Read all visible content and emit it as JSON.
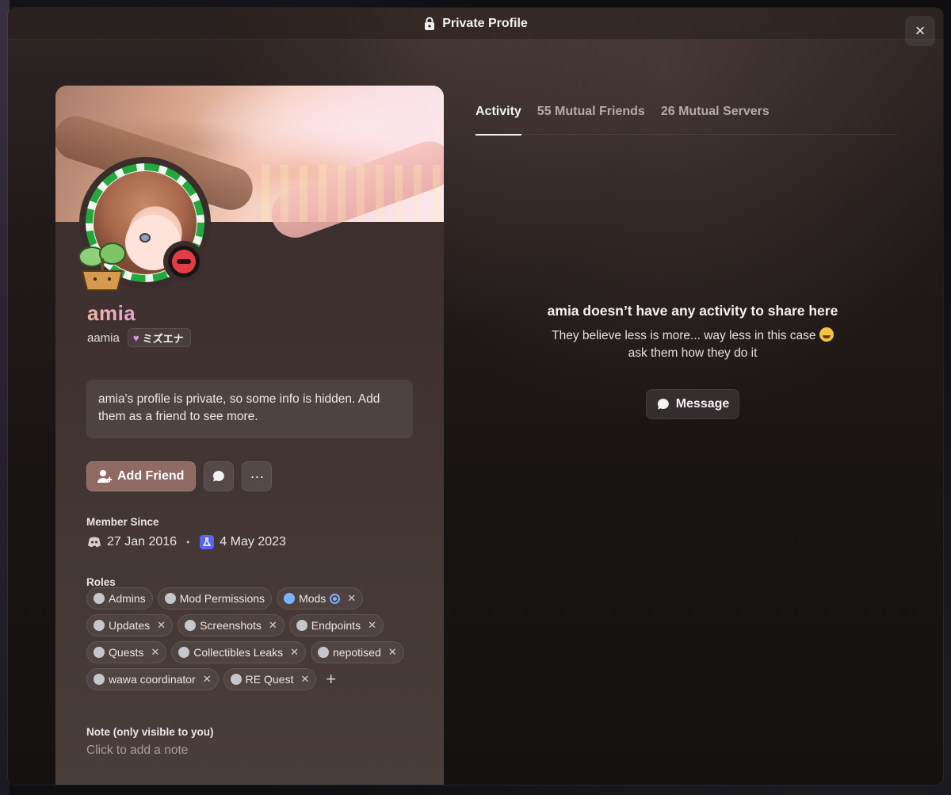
{
  "modal": {
    "title": "Private Profile",
    "close_label": "×"
  },
  "profile": {
    "display_name": "amia",
    "username": "aamia",
    "guild_tag": "ミズエナ",
    "private_notice": "amia's profile is private, so some info is hidden. Add them as a friend to see more.",
    "status": "do-not-disturb",
    "name_gradient": [
      "#f3b6a9",
      "#e79fd0"
    ]
  },
  "actions": {
    "add_friend_label": "Add Friend",
    "message_icon": "chat-bubble-icon",
    "more_icon": "ellipsis-icon",
    "more_label": "···"
  },
  "member_since": {
    "label": "Member Since",
    "discord_date": "27 Jan 2016",
    "server_date": "4 May 2023"
  },
  "roles": {
    "label": "Roles",
    "rows": [
      [
        {
          "name": "Admins",
          "removable": false,
          "color": "#c4c7cc"
        },
        {
          "name": "Mod Permissions",
          "removable": false,
          "color": "#c4c7cc"
        },
        {
          "name": "Mods",
          "removable": true,
          "color": "#7ab2ff",
          "badge": true
        }
      ],
      [
        {
          "name": "Updates",
          "removable": true,
          "color": "#c4c7cc"
        },
        {
          "name": "Screenshots",
          "removable": true,
          "color": "#c4c7cc"
        },
        {
          "name": "Endpoints",
          "removable": true,
          "color": "#c4c7cc"
        }
      ],
      [
        {
          "name": "Quests",
          "removable": true,
          "color": "#c4c7cc"
        },
        {
          "name": "Collectibles Leaks",
          "removable": true,
          "color": "#c4c7cc"
        },
        {
          "name": "nepotised",
          "removable": true,
          "color": "#c4c7cc"
        }
      ],
      [
        {
          "name": "wawa coordinator",
          "removable": true,
          "color": "#c4c7cc"
        },
        {
          "name": "RE Quest",
          "removable": true,
          "color": "#c4c7cc"
        }
      ]
    ],
    "add_label": "+"
  },
  "note": {
    "label": "Note (only visible to you)",
    "placeholder": "Click to add a note"
  },
  "tabs": [
    {
      "label": "Activity",
      "active": true
    },
    {
      "label": "55 Mutual Friends",
      "active": false
    },
    {
      "label": "26 Mutual Servers",
      "active": false
    }
  ],
  "activity_empty": {
    "heading": "amia doesn’t have any activity to share here",
    "line1": "They believe less is more... way less in this case",
    "line2": "ask them how they do it",
    "message_label": "Message"
  }
}
